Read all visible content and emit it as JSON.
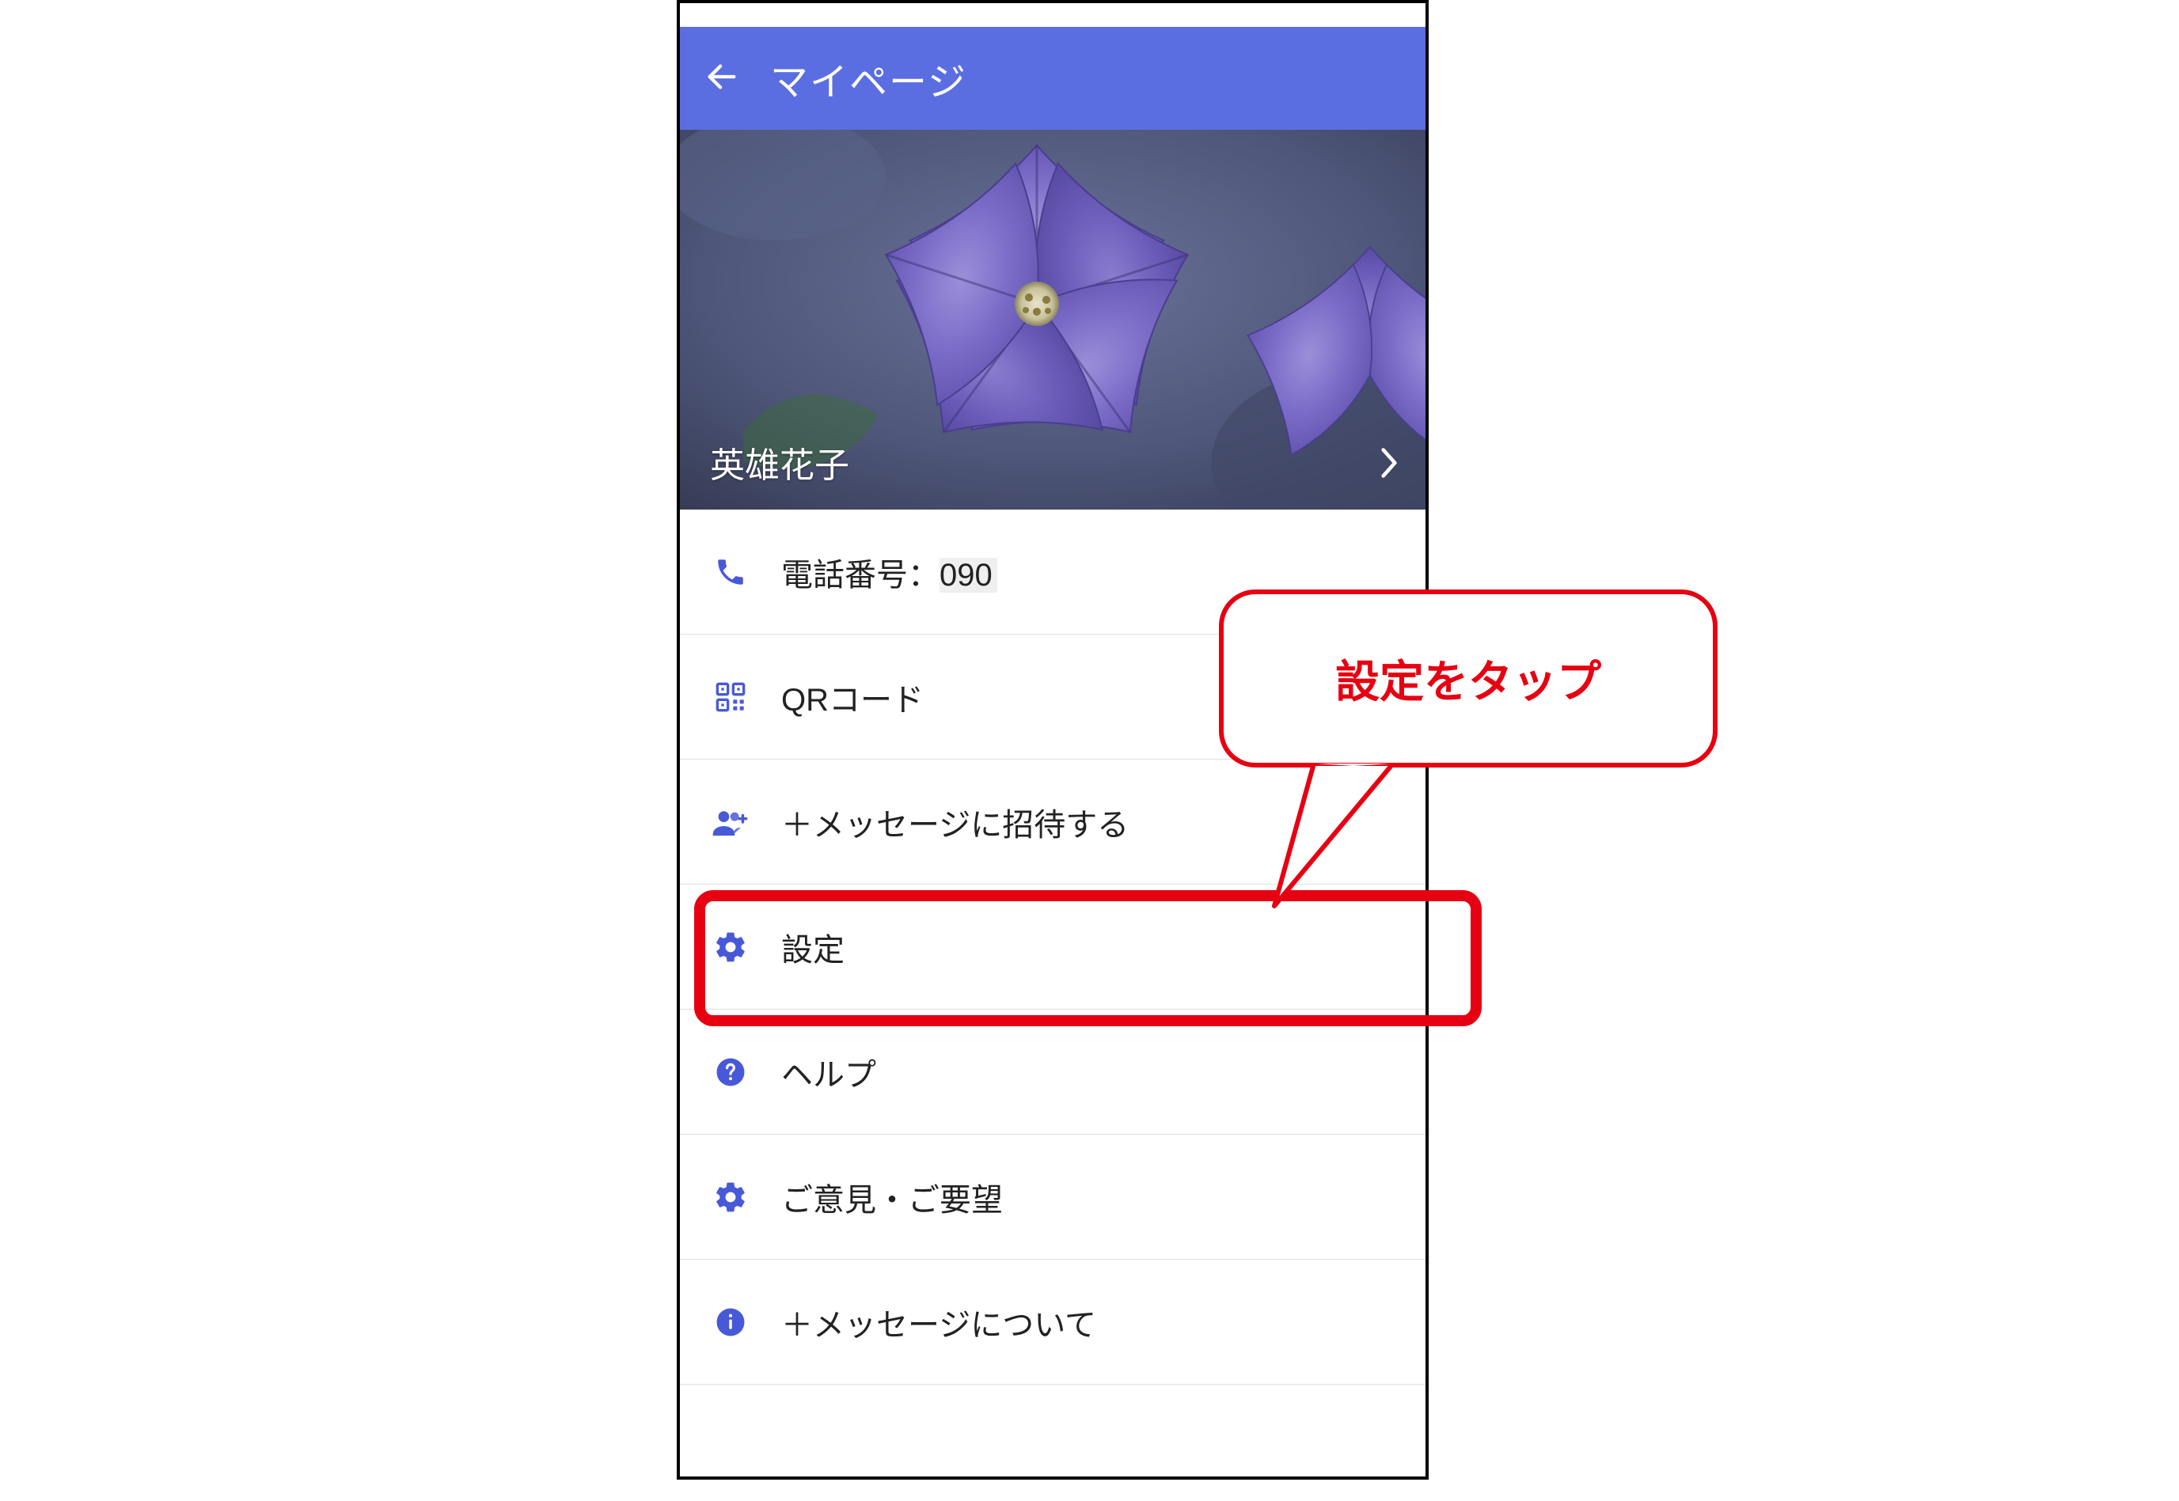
{
  "header": {
    "title": "マイページ"
  },
  "profile": {
    "name": "英雄花子"
  },
  "menu": {
    "phone": {
      "label_prefix": "電話番号：",
      "number": "090"
    },
    "qr": {
      "label": "QRコード"
    },
    "invite": {
      "label": "＋メッセージに招待する"
    },
    "settings": {
      "label": "設定"
    },
    "help": {
      "label": "ヘルプ"
    },
    "feedback": {
      "label": "ご意見・ご要望"
    },
    "about": {
      "label": "＋メッセージについて"
    }
  },
  "callout": {
    "text": "設定をタップ"
  }
}
